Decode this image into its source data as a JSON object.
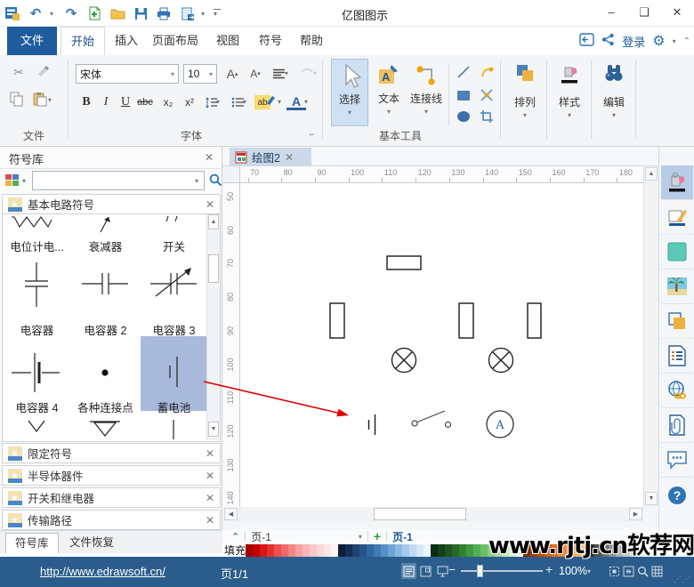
{
  "window": {
    "title": "亿图图示",
    "controls": {
      "minimize": "–",
      "maximize": "❑",
      "close": "✕"
    }
  },
  "quick_access": {
    "undo": "↶",
    "redo": "↷"
  },
  "ribbon": {
    "file_tab": "文件",
    "tabs": [
      {
        "label": "开始"
      },
      {
        "label": "插入"
      },
      {
        "label": "页面布局"
      },
      {
        "label": "视图"
      },
      {
        "label": "符号"
      },
      {
        "label": "帮助"
      }
    ],
    "login": "登录",
    "file_group": {
      "label": "文件"
    },
    "font_group": {
      "label": "字体",
      "font_name": "宋体",
      "font_size": "10",
      "bold": "B",
      "italic": "I",
      "underline": "U",
      "strike": "abc",
      "subscript": "x₂",
      "superscript": "x²",
      "grow": "A",
      "shrink": "A",
      "font_color": "A",
      "highlight": "ab"
    },
    "tools_group": {
      "label": "基本工具",
      "select": "选择",
      "text": "文本",
      "connector": "连接线"
    },
    "arrange_label": "排列",
    "style_label": "样式",
    "edit_label": "编辑"
  },
  "symbol_panel": {
    "title": "符号库",
    "search_placeholder": "",
    "top_section": "基本电路符号",
    "symbols": [
      {
        "label": "电位计电..."
      },
      {
        "label": "衰减器"
      },
      {
        "label": "开关"
      },
      {
        "label": "电容器"
      },
      {
        "label": "电容器 2"
      },
      {
        "label": "电容器 3"
      },
      {
        "label": "电容器 4"
      },
      {
        "label": "各种连接点"
      },
      {
        "label": "蓄电池",
        "selected": true
      }
    ],
    "sections": [
      {
        "label": "限定符号"
      },
      {
        "label": "半导体器件"
      },
      {
        "label": "开关和继电器"
      },
      {
        "label": "传输路径"
      }
    ],
    "bottom_tabs": [
      {
        "label": "符号库",
        "active": true
      },
      {
        "label": "文件恢复"
      }
    ]
  },
  "canvas": {
    "doc_tab": "绘图2",
    "h_ruler": [
      70,
      80,
      90,
      100,
      110,
      120,
      130,
      140,
      150,
      160,
      170,
      180
    ],
    "v_ruler": [
      50,
      60,
      70,
      80,
      90,
      100,
      110,
      120,
      130,
      140
    ],
    "ammeter_label": "A"
  },
  "pages": {
    "dropdown_page": "页-1",
    "add": "+",
    "active_page": "页-1"
  },
  "palette": {
    "fill_label": "填充",
    "colors": [
      "#a50000",
      "#c00000",
      "#d91515",
      "#e63030",
      "#ec4f4f",
      "#f06a6a",
      "#f38585",
      "#f6a0a0",
      "#f8b6b6",
      "#fac8c8",
      "#fbd8d8",
      "#fde6e6",
      "#fef2f2",
      "#0d1f3c",
      "#152f55",
      "#1d4370",
      "#265689",
      "#3168a0",
      "#3f7ab4",
      "#5590c6",
      "#6fa5d4",
      "#8ab8e0",
      "#a6caeb",
      "#c0daf2",
      "#d8e8f8",
      "#ecf4fc",
      "#0e2e12",
      "#154018",
      "#1d5420",
      "#266a28",
      "#318231",
      "#3f9a40",
      "#52ae52",
      "#6cbf68",
      "#88cd82",
      "#a5da9e",
      "#c0e6ba",
      "#d8f0d4",
      "#ecf8ea",
      "#7a2e00",
      "#9a3d00",
      "#b84d00",
      "#d05e10",
      "#e37020",
      "#ef8433",
      "#f59a4d",
      "#f9b06a",
      "#fbc68c",
      "#303030",
      "#505050",
      "#707070",
      "#909090",
      "#b0b0b0",
      "#c8c8c8",
      "#dcdcdc",
      "#ececec",
      "#f8f8f8"
    ]
  },
  "watermark": "www.rjtj.cn软荐网",
  "status_bar": {
    "link": "http://www.edrawsoft.cn/",
    "page_info": "页1/1",
    "zoom_level": "100%"
  }
}
